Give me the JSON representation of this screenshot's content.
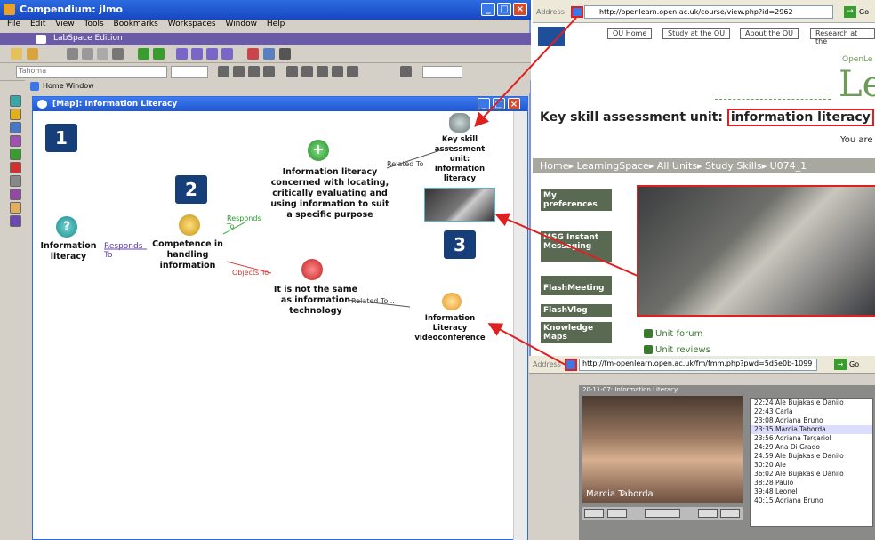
{
  "compendium": {
    "title": "Compendium: jlmo",
    "menu": [
      "File",
      "Edit",
      "View",
      "Tools",
      "Bookmarks",
      "Workspaces",
      "Window",
      "Help"
    ],
    "band_label": "LabSpace Edition",
    "font_combo": "Tahoma",
    "home_window": "Home Window",
    "map_title": "[Map]: Information Literacy"
  },
  "map": {
    "markers": [
      "1",
      "2",
      "3"
    ],
    "nodes": {
      "info_literacy": "Information literacy",
      "competence": "Competence in handling information",
      "concerned": "Information literacy concerned with locating, critically evaluating and using information to suit a specific purpose",
      "not_same": "It is not the same as information technology",
      "key_skill": "Key skill assessment unit: information literacy",
      "videoconf": "Information Literacy videoconference"
    },
    "links": {
      "responds_to_1": "Responds To",
      "responds_to_2": "Responds To",
      "related_to_1": "Related To",
      "objects_to": "Objects To",
      "related_to_2": "Related To..."
    }
  },
  "browser": {
    "address_label": "Address",
    "url": "http://openlearn.open.ac.uk/course/view.php?id=2962",
    "go_label": "Go",
    "nav_buttons": [
      "OU Home",
      "Study at the OU",
      "About the OU",
      "Research at the"
    ],
    "brand_partial": "Le",
    "brand_small": "OpenLe",
    "heading_prefix": "Key skill assessment unit:",
    "heading_highlight": "information literacy",
    "you_are": "You are",
    "breadcrumb": "Home▸ LearningSpace▸ All Units▸ Study Skills▸ U074_1",
    "side_items": [
      "My preferences",
      "MSG Instant Messaging",
      "FlashMeeting",
      "FlashVlog",
      "Knowledge Maps"
    ],
    "unit_links": [
      "Unit forum",
      "Unit reviews"
    ]
  },
  "flashmeeting": {
    "address_label": "Address",
    "url": "http://fm-openlearn.open.ac.uk/fm/fmm.php?pwd=5d5e0b-1099",
    "go_label": "Go",
    "video_header": "20-11-07: Information Literacy",
    "video_caption": "Marcia Taborda",
    "participants": [
      {
        "time": "22:24",
        "name": "Ale Bujakas e Danilo"
      },
      {
        "time": "22:43",
        "name": "Carla"
      },
      {
        "time": "23:08",
        "name": "Adriana Bruno"
      },
      {
        "time": "23:35",
        "name": "Marcia Taborda"
      },
      {
        "time": "23:56",
        "name": "Adriana Terçariol"
      },
      {
        "time": "24:29",
        "name": "Ana Di Grado"
      },
      {
        "time": "24:59",
        "name": "Ale Bujakas e Danilo"
      },
      {
        "time": "30:20",
        "name": "Ale"
      },
      {
        "time": "36:02",
        "name": "Ale Bujakas e Danilo"
      },
      {
        "time": "38:28",
        "name": "Paulo"
      },
      {
        "time": "39:48",
        "name": "Leonel"
      },
      {
        "time": "40:15",
        "name": "Adriana Bruno"
      }
    ],
    "selected_index": 3
  },
  "colors": {
    "highlight": "#e02020",
    "titlebar": "#1f56d3",
    "marker": "#163e78"
  }
}
